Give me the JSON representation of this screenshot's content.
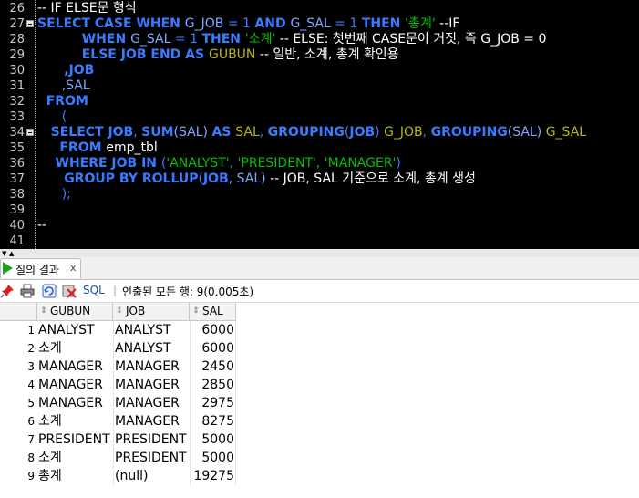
{
  "editor": {
    "line_numbers": [
      "26",
      "27",
      "28",
      "29",
      "30",
      "31",
      "32",
      "33",
      "34",
      "35",
      "36",
      "37",
      "38",
      "39",
      "40",
      "41"
    ],
    "lines": [
      [
        {
          "t": "-- IF ELSE문 형식",
          "c": "cmt"
        }
      ],
      [
        {
          "t": "SELECT CASE WHEN ",
          "c": "kw"
        },
        {
          "t": "G_JOB ",
          "c": "id"
        },
        {
          "t": "= 1 ",
          "c": "op"
        },
        {
          "t": "AND ",
          "c": "kw"
        },
        {
          "t": "G_SAL ",
          "c": "id"
        },
        {
          "t": "= 1 ",
          "c": "op"
        },
        {
          "t": "THEN ",
          "c": "kw"
        },
        {
          "t": "'총계'",
          "c": "str"
        },
        {
          "t": " --IF",
          "c": "cmt"
        }
      ],
      [
        {
          "t": "          WHEN ",
          "c": "kw"
        },
        {
          "t": "G_SAL ",
          "c": "id"
        },
        {
          "t": "= 1 ",
          "c": "op"
        },
        {
          "t": "THEN ",
          "c": "kw"
        },
        {
          "t": "'소계'",
          "c": "str"
        },
        {
          "t": " -- ELSE: 첫번째 CASE문이 거짓, 즉 G_JOB = 0",
          "c": "cmt"
        }
      ],
      [
        {
          "t": "          ELSE JOB END AS ",
          "c": "kw"
        },
        {
          "t": "GUBUN",
          "c": "ylw"
        },
        {
          "t": " -- 일반, 소계, 총계 확인용",
          "c": "cmt"
        }
      ],
      [
        {
          "t": "      ,JOB",
          "c": "kw"
        }
      ],
      [
        {
          "t": "      ,SAL",
          "c": "id"
        }
      ],
      [
        {
          "t": "  FROM",
          "c": "kw"
        }
      ],
      [
        {
          "t": "      (",
          "c": "op"
        }
      ],
      [
        {
          "t": "   SELECT JOB",
          "c": "kw"
        },
        {
          "t": ", ",
          "c": "op"
        },
        {
          "t": "SUM",
          "c": "kw"
        },
        {
          "t": "(SAL) ",
          "c": "id"
        },
        {
          "t": "AS ",
          "c": "kw"
        },
        {
          "t": "SAL",
          "c": "ylw"
        },
        {
          "t": ", ",
          "c": "op"
        },
        {
          "t": "GROUPING",
          "c": "kw"
        },
        {
          "t": "(",
          "c": "op"
        },
        {
          "t": "JOB",
          "c": "kw"
        },
        {
          "t": ") ",
          "c": "op"
        },
        {
          "t": "G_JOB",
          "c": "ylw"
        },
        {
          "t": ", ",
          "c": "op"
        },
        {
          "t": "GROUPING",
          "c": "kw"
        },
        {
          "t": "(SAL) ",
          "c": "id"
        },
        {
          "t": "G_SAL",
          "c": "ylw"
        }
      ],
      [
        {
          "t": "     FROM ",
          "c": "kw"
        },
        {
          "t": "emp_tbl",
          "c": "cmt"
        }
      ],
      [
        {
          "t": "    WHERE JOB IN ",
          "c": "kw"
        },
        {
          "t": "(",
          "c": "op"
        },
        {
          "t": "'ANALYST', 'PRESIDENT', 'MANAGER'",
          "c": "str"
        },
        {
          "t": ")",
          "c": "op"
        }
      ],
      [
        {
          "t": "      GROUP BY ROLLUP",
          "c": "kw"
        },
        {
          "t": "(",
          "c": "op"
        },
        {
          "t": "JOB",
          "c": "kw"
        },
        {
          "t": ", SAL) ",
          "c": "id"
        },
        {
          "t": "-- JOB, SAL 기준으로 소계, 총계 생성",
          "c": "cmt"
        }
      ],
      [
        {
          "t": "      );",
          "c": "op"
        }
      ],
      [
        {
          "t": "",
          "c": "cmt"
        }
      ],
      [
        {
          "t": "--",
          "c": "cmt"
        }
      ],
      [
        {
          "t": "",
          "c": "cmt"
        }
      ]
    ],
    "fold_rows": [
      1,
      8
    ]
  },
  "results_tab": {
    "label": "질의 결과",
    "close": "x"
  },
  "toolbar": {
    "sql_label": "SQL",
    "separator": "|",
    "status": "인출된 모든 행: 9(0.005초)"
  },
  "grid": {
    "columns": [
      "GUBUN",
      "JOB",
      "SAL"
    ],
    "rows": [
      {
        "n": "1",
        "gubun": "ANALYST",
        "job": "ANALYST",
        "sal": "6000"
      },
      {
        "n": "2",
        "gubun": "소계",
        "job": "ANALYST",
        "sal": "6000"
      },
      {
        "n": "3",
        "gubun": "MANAGER",
        "job": "MANAGER",
        "sal": "2450"
      },
      {
        "n": "4",
        "gubun": "MANAGER",
        "job": "MANAGER",
        "sal": "2850"
      },
      {
        "n": "5",
        "gubun": "MANAGER",
        "job": "MANAGER",
        "sal": "2975"
      },
      {
        "n": "6",
        "gubun": "소계",
        "job": "MANAGER",
        "sal": "8275"
      },
      {
        "n": "7",
        "gubun": "PRESIDENT",
        "job": "PRESIDENT",
        "sal": "5000"
      },
      {
        "n": "8",
        "gubun": "소계",
        "job": "PRESIDENT",
        "sal": "5000"
      },
      {
        "n": "9",
        "gubun": "총계",
        "job": "(null)",
        "sal": "19275"
      }
    ]
  }
}
